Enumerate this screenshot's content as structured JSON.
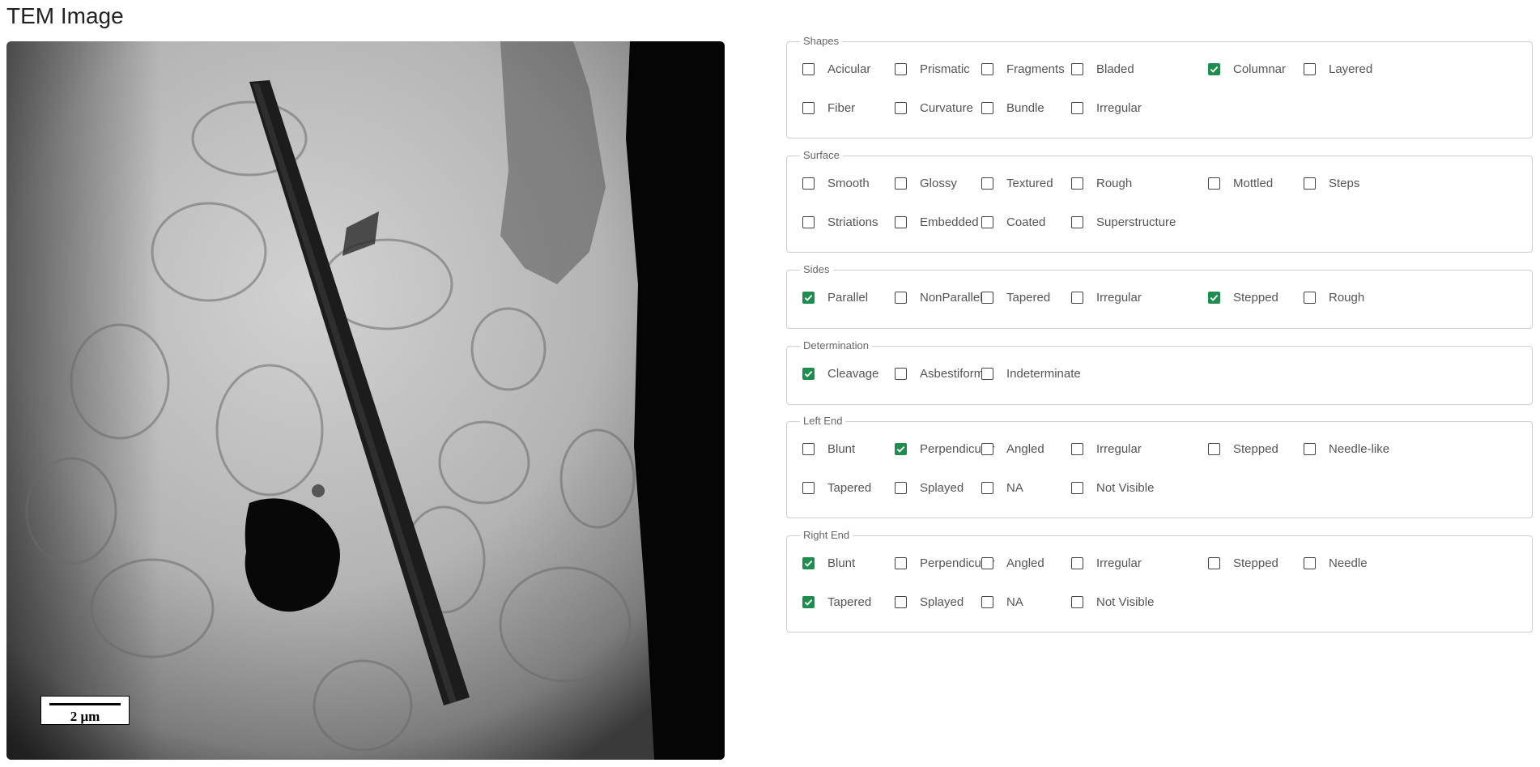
{
  "header": {
    "title": "TEM Image"
  },
  "image": {
    "scale_bar_label": "2 μm"
  },
  "accent_color": "#1e8e4e",
  "groups": [
    {
      "legend": "Shapes",
      "rows": [
        [
          {
            "label": "Acicular",
            "checked": false
          },
          {
            "label": "Prismatic",
            "checked": false
          },
          {
            "label": "Fragments",
            "checked": false
          },
          {
            "label": "Bladed",
            "checked": false
          },
          {
            "label": "Columnar",
            "checked": true
          },
          {
            "label": "Layered",
            "checked": false
          }
        ],
        [
          {
            "label": "Fiber",
            "checked": false
          },
          {
            "label": "Curvature",
            "checked": false
          },
          {
            "label": "Bundle",
            "checked": false
          },
          {
            "label": "Irregular",
            "checked": false
          }
        ]
      ]
    },
    {
      "legend": "Surface",
      "rows": [
        [
          {
            "label": "Smooth",
            "checked": false
          },
          {
            "label": "Glossy",
            "checked": false
          },
          {
            "label": "Textured",
            "checked": false
          },
          {
            "label": "Rough",
            "checked": false
          },
          {
            "label": "Mottled",
            "checked": false
          },
          {
            "label": "Steps",
            "checked": false
          }
        ],
        [
          {
            "label": "Striations",
            "checked": false
          },
          {
            "label": "Embedded",
            "checked": false
          },
          {
            "label": "Coated",
            "checked": false
          },
          {
            "label": "Superstructure",
            "checked": false
          }
        ]
      ]
    },
    {
      "legend": "Sides",
      "rows": [
        [
          {
            "label": "Parallel",
            "checked": true
          },
          {
            "label": "NonParallel",
            "checked": false
          },
          {
            "label": "Tapered",
            "checked": false
          },
          {
            "label": "Irregular",
            "checked": false
          },
          {
            "label": "Stepped",
            "checked": true
          },
          {
            "label": "Rough",
            "checked": false
          }
        ]
      ]
    },
    {
      "legend": "Determination",
      "rows": [
        [
          {
            "label": "Cleavage",
            "checked": true
          },
          {
            "label": "Asbestiform",
            "checked": false
          },
          {
            "label": "Indeterminate",
            "checked": false
          }
        ]
      ]
    },
    {
      "legend": "Left End",
      "rows": [
        [
          {
            "label": "Blunt",
            "checked": false
          },
          {
            "label": "Perpendicular",
            "checked": true
          },
          {
            "label": "Angled",
            "checked": false
          },
          {
            "label": "Irregular",
            "checked": false
          },
          {
            "label": "Stepped",
            "checked": false
          },
          {
            "label": "Needle-like",
            "checked": false
          }
        ],
        [
          {
            "label": "Tapered",
            "checked": false
          },
          {
            "label": "Splayed",
            "checked": false
          },
          {
            "label": "NA",
            "checked": false
          },
          {
            "label": "Not Visible",
            "checked": false
          }
        ]
      ]
    },
    {
      "legend": "Right End",
      "rows": [
        [
          {
            "label": "Blunt",
            "checked": true
          },
          {
            "label": "Perpendicular",
            "checked": false
          },
          {
            "label": "Angled",
            "checked": false
          },
          {
            "label": "Irregular",
            "checked": false
          },
          {
            "label": "Stepped",
            "checked": false
          },
          {
            "label": "Needle",
            "checked": false
          }
        ],
        [
          {
            "label": "Tapered",
            "checked": true
          },
          {
            "label": "Splayed",
            "checked": false
          },
          {
            "label": "NA",
            "checked": false
          },
          {
            "label": "Not Visible",
            "checked": false
          }
        ]
      ]
    }
  ]
}
